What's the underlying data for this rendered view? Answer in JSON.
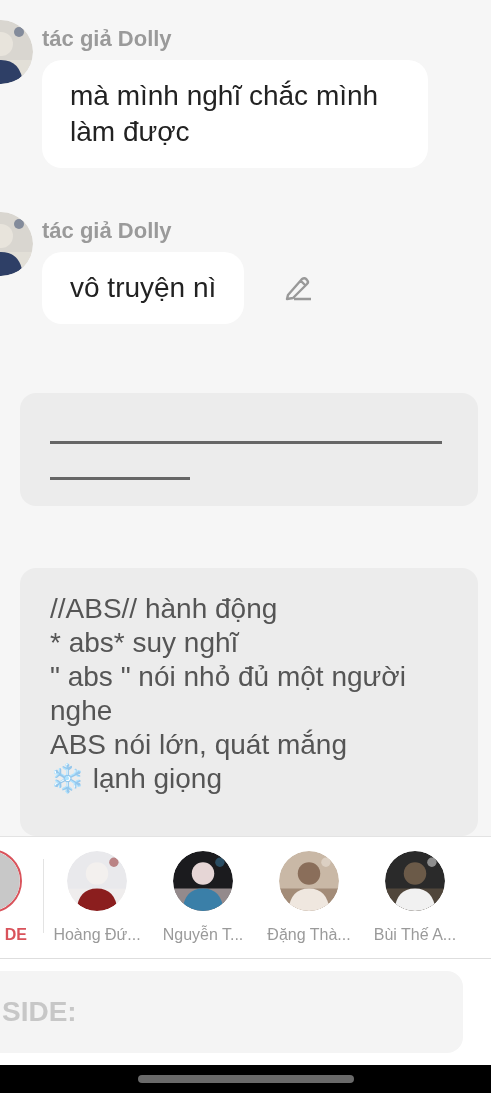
{
  "messages": [
    {
      "author": "tác giả Dolly",
      "text": "mà mình nghĩ chắc mình làm được",
      "editable": false
    },
    {
      "author": "tác giả Dolly",
      "text": "vô truyện nì",
      "editable": true
    }
  ],
  "notes": [
    {
      "kind": "blank"
    },
    {
      "kind": "text",
      "lines": [
        "//ABS// hành động",
        "* abs* suy nghĩ",
        "\" abs \" nói nhỏ đủ một người nghe",
        "ABS nói lớn, quát mắng",
        "❄️ lạnh giọng"
      ]
    }
  ],
  "contacts": [
    {
      "name": "DE",
      "selected": true
    },
    {
      "name": "Hoàng Đứ...",
      "selected": false
    },
    {
      "name": "Nguyễn T...",
      "selected": false
    },
    {
      "name": "Đặng Thà...",
      "selected": false
    },
    {
      "name": "Bùi Thế A...",
      "selected": false
    }
  ],
  "composer": {
    "placeholder": "SIDE:"
  }
}
